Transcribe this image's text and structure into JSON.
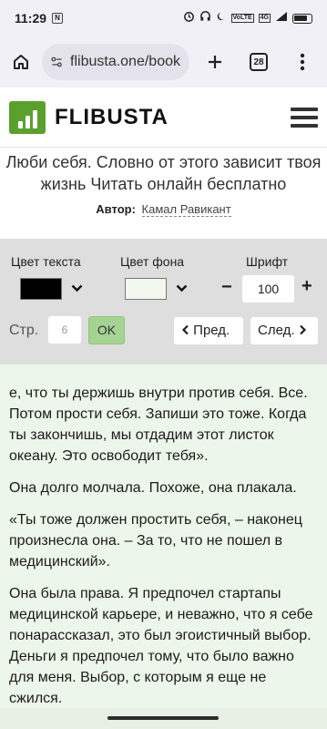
{
  "status": {
    "time": "11:29",
    "notification_badge": "N",
    "network_tag_1": "VoLTE",
    "network_tag_2": "4G"
  },
  "browser": {
    "url": "flibusta.one/book",
    "tab_count": "28"
  },
  "site": {
    "logo_text": "FLIBUSTA",
    "brand_color": "#5aa02c"
  },
  "book": {
    "title": "Люби себя. Словно от этого зависит твоя жизнь Читать онлайн бесплатно",
    "author_label": "Автор:",
    "author_name": "Камал Равикант"
  },
  "reader_controls": {
    "text_color_label": "Цвет текста",
    "text_color_value": "#000000",
    "bg_color_label": "Цвет фона",
    "bg_color_value": "#f2f8ef",
    "font_label": "Шрифт",
    "font_minus": "−",
    "font_size": "100",
    "font_plus": "+",
    "page_label": "Стр.",
    "page_placeholder": "6",
    "ok_label": "OK",
    "prev_label": "Пред.",
    "next_label": "След."
  },
  "content": {
    "paragraphs": [
      "е, что ты держишь внутри против себя. Все. Потом прости себя. Запиши это тоже. Когда ты закончишь, мы отдадим этот листок океану. Это освободит тебя».",
      "Она долго молчала. Похоже, она плакала.",
      "«Ты тоже должен простить себя, – наконец произнесла она. – За то, что не пошел в медицинский».",
      "Она была права. Я предпочел стартапы медицинской карьере, и неважно, что я себе понарассказал, это был эгоистичный выбор. Деньги я предпочел тому, что было важно для меня. Выбор, с которым я еще не сжился."
    ]
  }
}
